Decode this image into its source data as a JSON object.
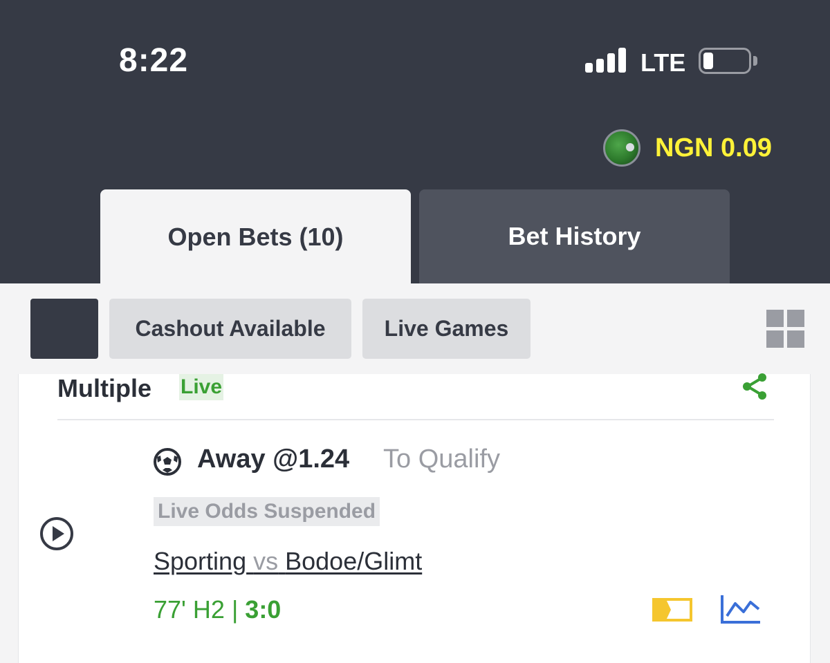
{
  "status_bar": {
    "time": "8:22",
    "network": "LTE",
    "icons": [
      "signal-icon",
      "battery-icon"
    ]
  },
  "account": {
    "balance": "NGN 0.09",
    "balance_color": "#fff238",
    "icon": "coin-icon"
  },
  "tabs": [
    {
      "label": "Open Bets (10)",
      "active": true
    },
    {
      "label": "Bet History",
      "active": false
    }
  ],
  "filters": {
    "chips": [
      {
        "label": "Cashout Available"
      },
      {
        "label": "Live Games"
      }
    ],
    "icons": [
      "grid-view-icon"
    ]
  },
  "bet": {
    "type": "Multiple",
    "live_badge": "Live",
    "selection": "Away @1.24",
    "market": "To Qualify",
    "status": "Live Odds Suspended",
    "home_team": "Sporting",
    "vs": "vs",
    "away_team": "Bodoe/Glimt",
    "match_time": "77' H2 | ",
    "score": "3:0",
    "icons": [
      "share-icon",
      "play-icon",
      "football-icon",
      "tag-icon",
      "stats-chart-icon"
    ]
  },
  "colors": {
    "header_bg": "#363a45",
    "live_green": "#3aa034",
    "accent_blue": "#3a6fd8",
    "tag_yellow": "#f5c62e"
  }
}
